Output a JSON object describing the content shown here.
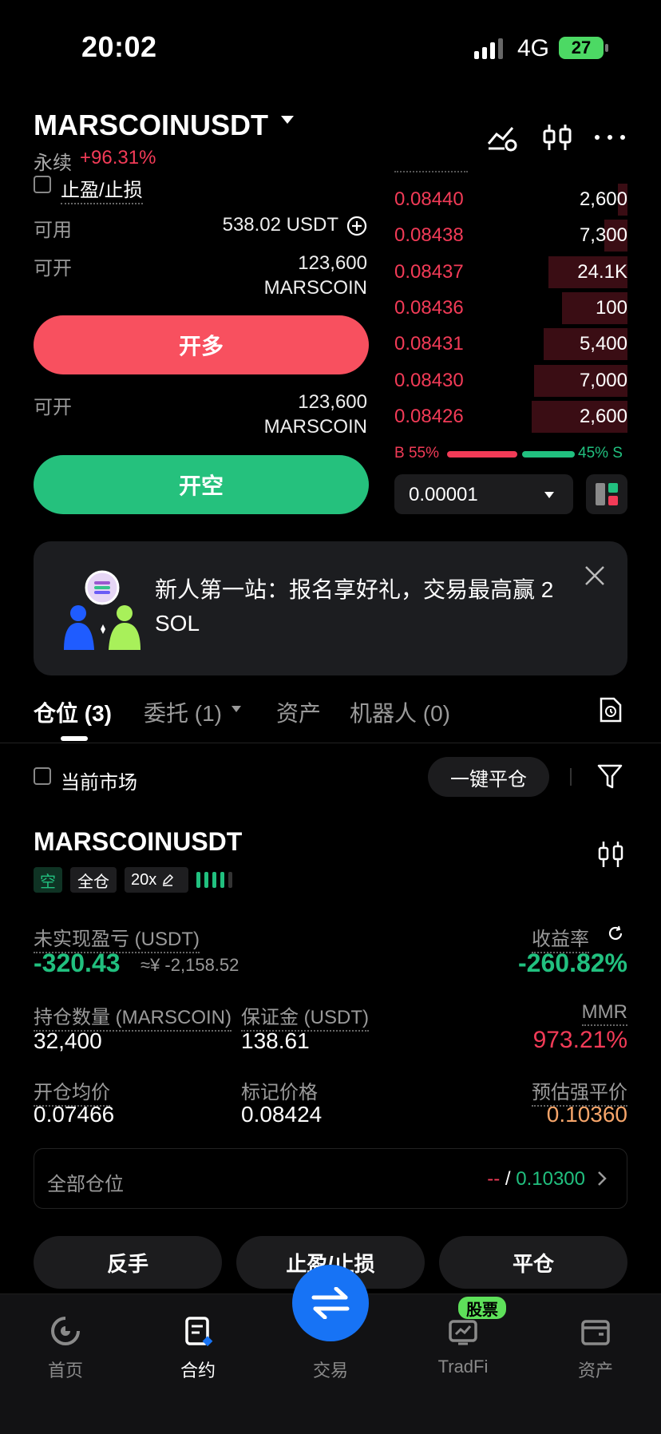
{
  "status_bar": {
    "time": "20:02",
    "network": "4G",
    "battery": "27"
  },
  "header": {
    "symbol": "MARSCOIN USDT",
    "symbol_display": "MARSCOINUSDT",
    "perpetual_label": "永续",
    "change": "+96.31%"
  },
  "order_form": {
    "tpsl_label": "止盈/止损",
    "available_label": "可用",
    "available_value": "538.02 USDT",
    "open_long_label": "可开",
    "open_long_qty": "123,600",
    "open_long_unit": "MARSCOIN",
    "long_button": "开多",
    "open_short_label": "可开",
    "open_short_qty": "123,600",
    "open_short_unit": "MARSCOIN",
    "short_button": "开空"
  },
  "orderbook": {
    "asks": [
      {
        "price": "0.08440",
        "qty": "2,600",
        "depth": 0.04
      },
      {
        "price": "0.08438",
        "qty": "7,300",
        "depth": 0.1
      },
      {
        "price": "0.08437",
        "qty": "24.1K",
        "depth": 0.34
      },
      {
        "price": "0.08436",
        "qty": "100",
        "depth": 0.28
      },
      {
        "price": "0.08431",
        "qty": "5,400",
        "depth": 0.36
      },
      {
        "price": "0.08430",
        "qty": "7,000",
        "depth": 0.4
      },
      {
        "price": "0.08426",
        "qty": "2,600",
        "depth": 0.41
      }
    ],
    "buy_ratio": "B 55%",
    "sell_ratio": "45% S",
    "precision": "0.00001"
  },
  "banner": {
    "text": "新人第一站：报名享好礼，交易最高赢 2 SOL"
  },
  "tabs": [
    {
      "label": "仓位 (3)"
    },
    {
      "label": "委托 (1)"
    },
    {
      "label": "资产"
    },
    {
      "label": "机器人 (0)"
    }
  ],
  "filter": {
    "current_market": "当前市场",
    "close_all": "一键平仓"
  },
  "position": {
    "symbol": "MARSCOINUSDT",
    "side_tag": "空",
    "margin_tag": "全仓",
    "leverage_tag": "20x",
    "upnl_label": "未实现盈亏 (USDT)",
    "upnl_value": "-320.43",
    "upnl_cny": "≈¥ -2,158.52",
    "roe_label": "收益率",
    "roe_value": "-260.82%",
    "qty_label": "持仓数量 (MARSCOIN)",
    "qty_value": "32,400",
    "margin_label": "保证金 (USDT)",
    "margin_value": "138.61",
    "mmr_label": "MMR",
    "mmr_value": "973.21%",
    "entry_label": "开仓均价",
    "entry_value": "0.07466",
    "mark_label": "标记价格",
    "mark_value": "0.08424",
    "liq_label": "预估强平价",
    "liq_value": "0.10360",
    "all_positions_label": "全部仓位",
    "all_positions_left": "--",
    "all_positions_sep": "/",
    "all_positions_right": "0.10300",
    "btn_reverse": "反手",
    "btn_tpsl": "止盈/止损",
    "btn_close": "平仓"
  },
  "nav": {
    "home": "首页",
    "futures": "合约",
    "trade": "交易",
    "tradfi": "TradFi",
    "tradfi_badge": "股票",
    "assets": "资产"
  },
  "colors": {
    "red": "#f23b57",
    "green": "#21c07f",
    "blue": "#1773f5"
  }
}
